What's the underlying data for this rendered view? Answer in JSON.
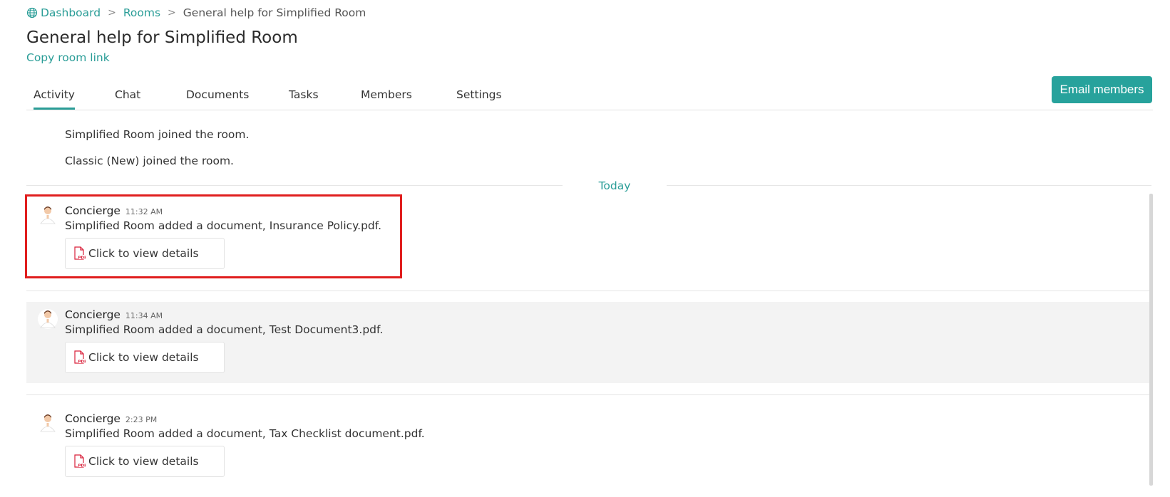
{
  "breadcrumb": {
    "dashboard": "Dashboard",
    "rooms": "Rooms",
    "current": "General help for Simplified Room",
    "separator": ">"
  },
  "page": {
    "title": "General help for Simplified Room",
    "copy_link": "Copy room link"
  },
  "tabs": [
    "Activity",
    "Chat",
    "Documents",
    "Tasks",
    "Members",
    "Settings"
  ],
  "active_tab": "Activity",
  "actions": {
    "email_members": "Email members"
  },
  "system_messages": [
    "Simplified Room joined the room.",
    "Classic (New) joined the room."
  ],
  "day_separator": "Today",
  "activity": [
    {
      "sender": "Concierge",
      "time": "11:32 AM",
      "message": "Simplified Room added a document, Insurance Policy.pdf.",
      "action": "Click to view details",
      "highlighted": true
    },
    {
      "sender": "Concierge",
      "time": "11:34 AM",
      "message": "Simplified Room added a document, Test Document3.pdf.",
      "action": "Click to view details",
      "highlighted": false
    },
    {
      "sender": "Concierge",
      "time": "2:23 PM",
      "message": "Simplified Room added a document, Tax Checklist document.pdf.",
      "action": "Click to view details",
      "highlighted": false
    }
  ],
  "colors": {
    "accent": "#2a9d97",
    "button": "#27a29c",
    "highlight": "#e01e1e",
    "pdf_icon": "#d9203a"
  },
  "icons": {
    "breadcrumb": "globe-icon",
    "document": "pdf-file-icon",
    "avatar": "concierge-avatar"
  }
}
